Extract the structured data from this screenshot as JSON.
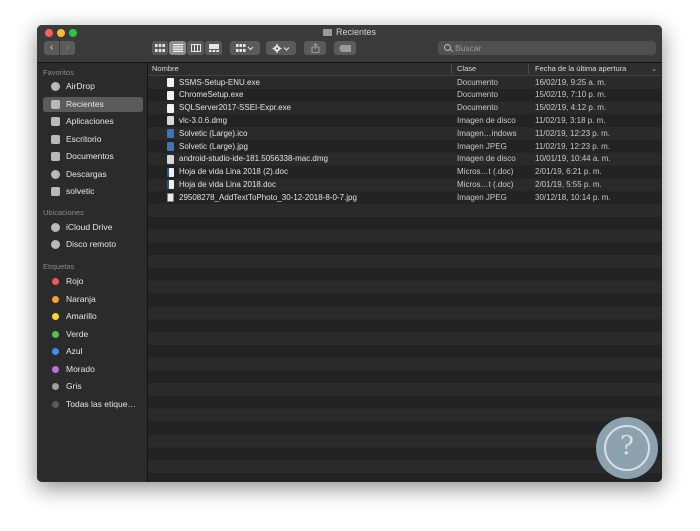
{
  "window": {
    "title": "Recientes"
  },
  "toolbar": {
    "back_glyph": "‹",
    "forward_glyph": "›",
    "search_placeholder": "Buscar"
  },
  "sidebar": {
    "favorites_header": "Favoritos",
    "favorites": [
      {
        "label": "AirDrop",
        "icon": "airdrop-icon"
      },
      {
        "label": "Recientes",
        "icon": "recents-icon",
        "selected": true
      },
      {
        "label": "Aplicaciones",
        "icon": "applications-icon"
      },
      {
        "label": "Escritorio",
        "icon": "desktop-icon"
      },
      {
        "label": "Documentos",
        "icon": "documents-icon"
      },
      {
        "label": "Descargas",
        "icon": "downloads-icon"
      },
      {
        "label": "solvetic",
        "icon": "home-icon"
      }
    ],
    "locations_header": "Ubicaciones",
    "locations": [
      {
        "label": "iCloud Drive",
        "icon": "cloud-icon"
      },
      {
        "label": "Disco remoto",
        "icon": "disc-icon"
      }
    ],
    "tags_header": "Etiquetas",
    "tags": [
      {
        "label": "Rojo",
        "color": "#f25a55"
      },
      {
        "label": "Naranja",
        "color": "#f7a236"
      },
      {
        "label": "Amarillo",
        "color": "#f6d43a"
      },
      {
        "label": "Verde",
        "color": "#58c04b"
      },
      {
        "label": "Azul",
        "color": "#3a8ff0"
      },
      {
        "label": "Morado",
        "color": "#bb73d5"
      },
      {
        "label": "Gris",
        "color": "#a0a0a4"
      },
      {
        "label": "Todas las etique…",
        "color": "#5a5a5a"
      }
    ]
  },
  "columns": {
    "name": "Nombre",
    "kind": "Clase",
    "date": "Fecha de la última apertura"
  },
  "files": [
    {
      "name": "SSMS-Setup-ENU.exe",
      "kind": "Documento",
      "date": "16/02/19, 9:25 a. m.",
      "icon": "exe"
    },
    {
      "name": "ChromeSetup.exe",
      "kind": "Documento",
      "date": "15/02/19, 7:10 p. m.",
      "icon": "exe"
    },
    {
      "name": "SQLServer2017-SSEI-Expr.exe",
      "kind": "Documento",
      "date": "15/02/19, 4:12 p. m.",
      "icon": "exe"
    },
    {
      "name": "vlc-3.0.6.dmg",
      "kind": "Imagen de disco",
      "date": "11/02/19, 3:18 p. m.",
      "icon": "dmg"
    },
    {
      "name": "Solvetic (Large).ico",
      "kind": "Imagen…indows",
      "date": "11/02/19, 12:23 p. m.",
      "icon": "img"
    },
    {
      "name": "Solvetic (Large).jpg",
      "kind": "Imagen JPEG",
      "date": "11/02/19, 12:23 p. m.",
      "icon": "img"
    },
    {
      "name": "android-studio-ide-181.5056338-mac.dmg",
      "kind": "Imagen de disco",
      "date": "10/01/19, 10:44 a. m.",
      "icon": "dmg"
    },
    {
      "name": "Hoja de vida Lina 2018 (2).doc",
      "kind": "Micros…t (.doc)",
      "date": "2/01/19, 6:21 p. m.",
      "icon": "doc"
    },
    {
      "name": "Hoja de vida Lina 2018.doc",
      "kind": "Micros…t (.doc)",
      "date": "2/01/19, 5:55 p. m.",
      "icon": "doc"
    },
    {
      "name": "29508278_AddTextToPhoto_30-12-2018-8-0-7.jpg",
      "kind": "Imagen JPEG",
      "date": "30/12/18, 10:14 p. m.",
      "icon": "jpgthumb"
    }
  ],
  "watermark": {
    "glyph": "?"
  }
}
